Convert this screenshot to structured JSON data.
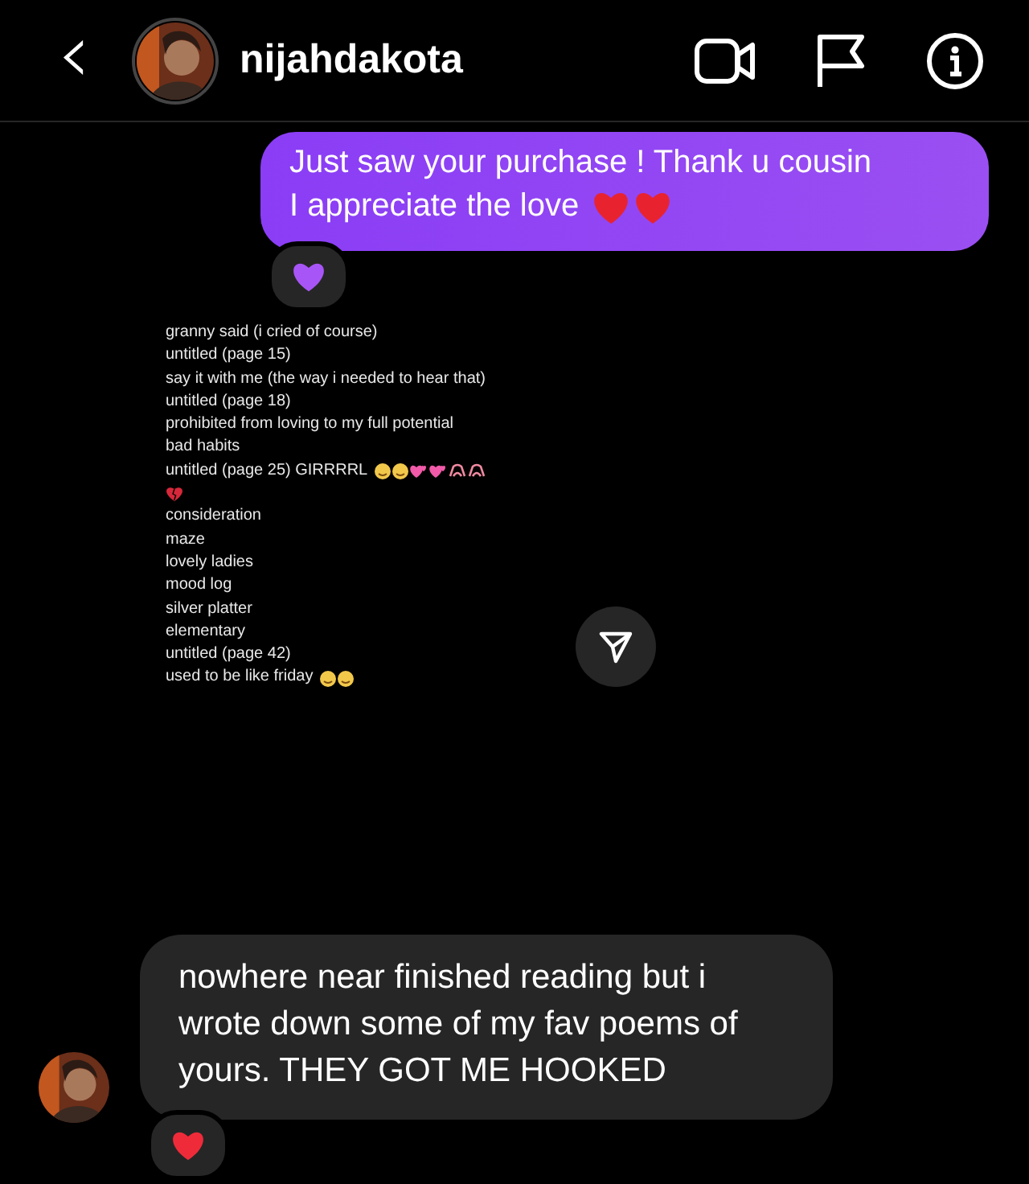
{
  "header": {
    "back": "‹",
    "username": "nijahdakota"
  },
  "messages": [
    {
      "kind": "sent",
      "lines": [
        "Just saw your purchase ! Thank u cousin",
        "I appreciate the love"
      ],
      "trailing_emojis": [
        {
          "kind": "heart"
        },
        {
          "kind": "heart"
        }
      ],
      "reaction": {
        "kind": "heart",
        "color": "#a855f7"
      }
    },
    {
      "kind": "shared_image",
      "lines": [
        {
          "text": "granny said (i cried of course)"
        },
        {
          "text": "untitled (page 15)"
        },
        {
          "text": "say it with me (the way i needed to hear that)"
        },
        {
          "text": "untitled (page 18)"
        },
        {
          "text": "prohibited from loving to my full potential"
        },
        {
          "text": "bad habits"
        },
        {
          "text": "untitled (page 25) GIRRRRL",
          "emojis": [
            {
              "kind": "face"
            },
            {
              "kind": "face"
            },
            {
              "kind": "hearts"
            },
            {
              "kind": "hearts"
            },
            {
              "kind": "hands"
            },
            {
              "kind": "hands"
            }
          ]
        },
        {
          "emojis": [
            {
              "kind": "broken"
            }
          ]
        },
        {
          "text": "consideration"
        },
        {
          "text": "maze"
        },
        {
          "text": "lovely ladies"
        },
        {
          "text": "mood log"
        },
        {
          "text": "silver platter"
        },
        {
          "text": "elementary"
        },
        {
          "text": "untitled (page 42)"
        },
        {
          "text": "used to be like friday",
          "emojis": [
            {
              "kind": "face"
            },
            {
              "kind": "face"
            }
          ]
        }
      ]
    },
    {
      "kind": "received",
      "lines": [
        "nowhere near finished reading but i wrote down some of my fav poems of yours. THEY GOT ME HOOKED"
      ],
      "reaction": {
        "kind": "heart",
        "color": "#ef2b3a"
      }
    }
  ]
}
